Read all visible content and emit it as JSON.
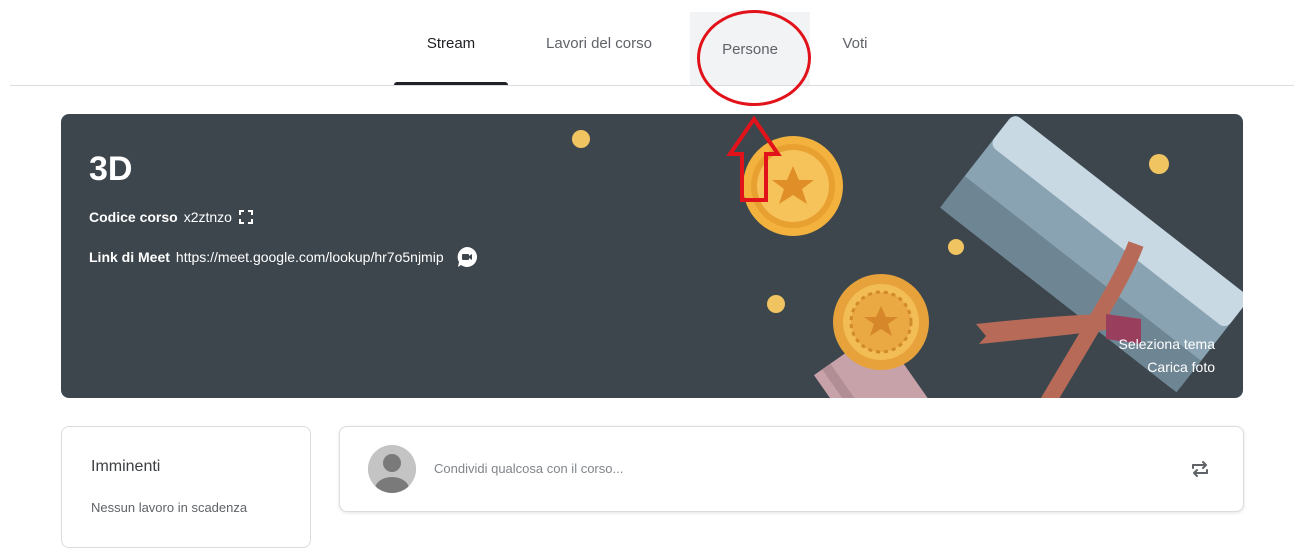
{
  "tabs": [
    {
      "label": "Stream",
      "active": true
    },
    {
      "label": "Lavori del corso",
      "active": false
    },
    {
      "label": "Persone",
      "active": false
    },
    {
      "label": "Voti",
      "active": false
    }
  ],
  "banner": {
    "course_name": "3D",
    "code_label": "Codice corso",
    "code_value": "x2ztnzo",
    "meet_label": "Link di Meet",
    "meet_value": "https://meet.google.com/lookup/hr7o5njmip",
    "select_theme": "Seleziona tema",
    "upload_photo": "Carica foto",
    "background_color": "#3d464d"
  },
  "upcoming": {
    "title": "Imminenti",
    "empty_text": "Nessun lavoro in scadenza"
  },
  "share": {
    "placeholder": "Condividi qualcosa con il corso..."
  },
  "annotations": {
    "color": "#e2121a"
  },
  "icons": {
    "expand": "expand-icon",
    "meet": "meet-video-icon",
    "repost": "repost-icon",
    "avatar": "user-avatar-icon"
  }
}
